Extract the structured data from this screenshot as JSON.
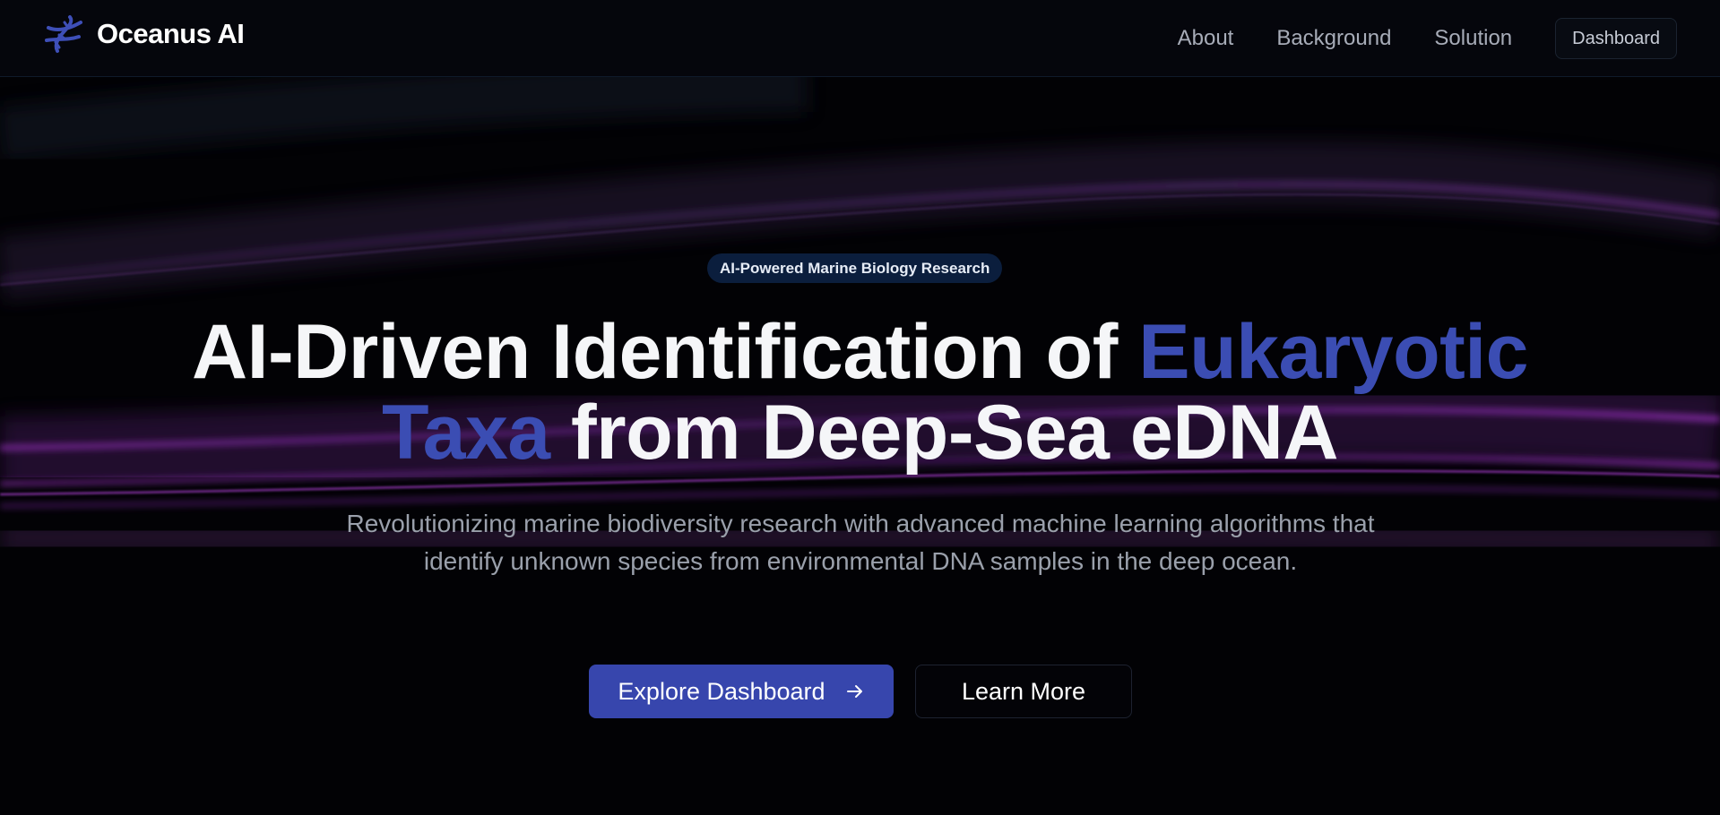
{
  "nav": {
    "brand_name": "Oceanus AI",
    "brand_icon": "dna-helix-icon",
    "links": [
      "About",
      "Background",
      "Solution"
    ],
    "dashboard_label": "Dashboard"
  },
  "hero": {
    "badge": "AI-Powered Marine Biology Research",
    "headline": {
      "part1": "AI-Driven Identification of ",
      "accent1": "Eukaryotic",
      "accent2": "Taxa",
      "part2": " from Deep-Sea eDNA"
    },
    "subtitle": "Revolutionizing marine biodiversity research with advanced machine learning algorithms that identify unknown species from environmental DNA samples in the deep ocean.",
    "primary_cta": "Explore Dashboard",
    "primary_cta_icon": "arrow-right-icon",
    "secondary_cta": "Learn More"
  },
  "colors": {
    "background": "#020205",
    "accent": "#3b4db3",
    "button_primary": "#3746ad",
    "badge_bg": "#0b1e3d",
    "wave_purple": "#a020c8",
    "muted_text": "#9aa0ab"
  }
}
